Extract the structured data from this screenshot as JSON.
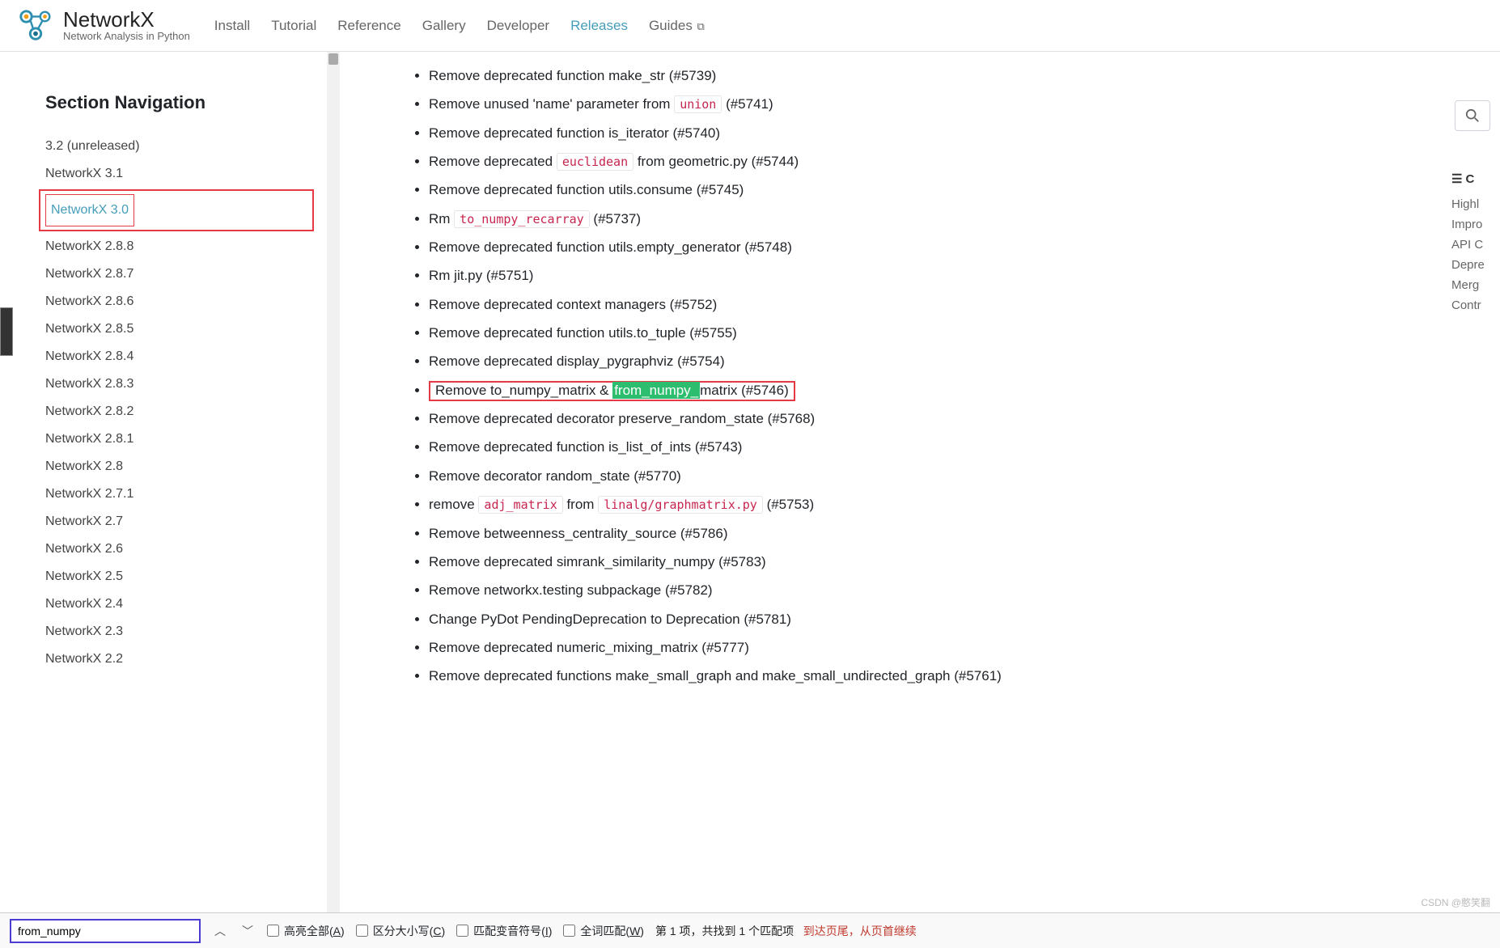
{
  "brand": {
    "name": "NetworkX",
    "tagline": "Network Analysis in Python"
  },
  "topnav": {
    "install": "Install",
    "tutorial": "Tutorial",
    "reference": "Reference",
    "gallery": "Gallery",
    "developer": "Developer",
    "releases": "Releases",
    "guides": "Guides"
  },
  "sidebar": {
    "heading": "Section Navigation",
    "items": [
      "3.2 (unreleased)",
      "NetworkX 3.1",
      "NetworkX 3.0",
      "NetworkX 2.8.8",
      "NetworkX 2.8.7",
      "NetworkX 2.8.6",
      "NetworkX 2.8.5",
      "NetworkX 2.8.4",
      "NetworkX 2.8.3",
      "NetworkX 2.8.2",
      "NetworkX 2.8.1",
      "NetworkX 2.8",
      "NetworkX 2.7.1",
      "NetworkX 2.7",
      "NetworkX 2.6",
      "NetworkX 2.5",
      "NetworkX 2.4",
      "NetworkX 2.3",
      "NetworkX 2.2"
    ],
    "active_index": 2
  },
  "content": {
    "items": [
      {
        "pre": "Remove deprecated function make_str (#5739)"
      },
      {
        "pre": "Remove unused 'name' parameter from ",
        "code": "union",
        "post": " (#5741)"
      },
      {
        "pre": "Remove deprecated function is_iterator (#5740)"
      },
      {
        "pre": "Remove deprecated ",
        "code": "euclidean",
        "post": " from geometric.py (#5744)"
      },
      {
        "pre": "Remove deprecated function utils.consume (#5745)"
      },
      {
        "pre": "Rm ",
        "code": "to_numpy_recarray",
        "post": " (#5737)"
      },
      {
        "pre": "Remove deprecated function utils.empty_generator (#5748)"
      },
      {
        "pre": "Rm jit.py (#5751)"
      },
      {
        "pre": "Remove deprecated context managers (#5752)"
      },
      {
        "pre": "Remove deprecated function utils.to_tuple (#5755)"
      },
      {
        "pre": "Remove deprecated display_pygraphviz (#5754)"
      },
      {
        "pre": "Remove to_numpy_matrix & ",
        "match": "from_numpy_",
        "post": "matrix (#5746)",
        "highlight_row": true
      },
      {
        "pre": "Remove deprecated decorator preserve_random_state (#5768)"
      },
      {
        "pre": "Remove deprecated function is_list_of_ints (#5743)"
      },
      {
        "pre": "Remove decorator random_state (#5770)"
      },
      {
        "pre": "remove ",
        "code": "adj_matrix",
        "mid": " from ",
        "code2": "linalg/graphmatrix.py",
        "post": " (#5753)"
      },
      {
        "pre": "Remove betweenness_centrality_source (#5786)"
      },
      {
        "pre": "Remove deprecated simrank_similarity_numpy (#5783)"
      },
      {
        "pre": "Remove networkx.testing subpackage (#5782)"
      },
      {
        "pre": "Change PyDot PendingDeprecation to Deprecation (#5781)"
      },
      {
        "pre": "Remove deprecated numeric_mixing_matrix (#5777)"
      },
      {
        "pre": "Remove deprecated functions make_small_graph and make_small_undirected_graph (#5761)"
      }
    ]
  },
  "toc": {
    "heading": "C",
    "items": [
      "Highl",
      "Impro",
      "API C",
      "Depre",
      "Merg",
      "Contr"
    ]
  },
  "findbar": {
    "value": "from_numpy",
    "highlight_all": "高亮全部(",
    "highlight_all_key": "A",
    "highlight_all_end": ")",
    "match_case": "区分大小写(",
    "match_case_key": "C",
    "match_case_end": ")",
    "diacritics": "匹配变音符号(",
    "diacritics_key": "I",
    "diacritics_end": ")",
    "whole_words": "全词匹配(",
    "whole_words_key": "W",
    "whole_words_end": ")",
    "count": "第 1 项，共找到 1 个匹配项",
    "wrap": "到达页尾，从页首继续"
  },
  "watermark": "CSDN @憨笑翻"
}
